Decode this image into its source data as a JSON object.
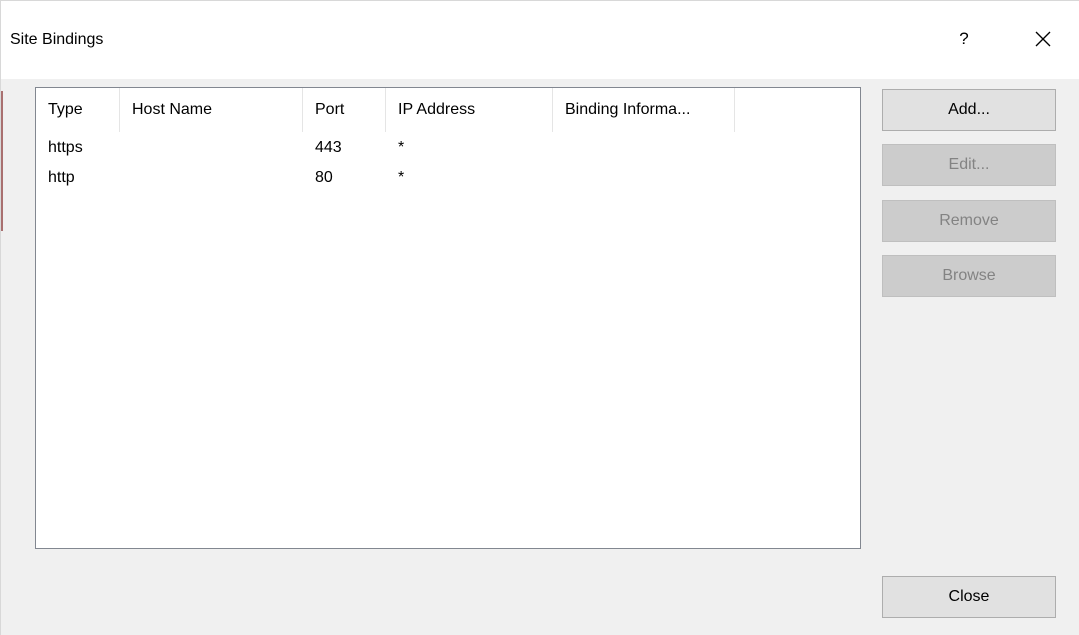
{
  "window": {
    "title": "Site Bindings",
    "help_label": "?"
  },
  "list": {
    "columns": [
      "Type",
      "Host Name",
      "Port",
      "IP Address",
      "Binding Informa..."
    ],
    "rows": [
      {
        "type": "https",
        "host_name": "",
        "port": "443",
        "ip_address": "*",
        "binding_info": ""
      },
      {
        "type": "http",
        "host_name": "",
        "port": "80",
        "ip_address": "*",
        "binding_info": ""
      }
    ]
  },
  "buttons": {
    "add": "Add...",
    "edit": "Edit...",
    "remove": "Remove",
    "browse": "Browse",
    "close": "Close"
  },
  "button_states": {
    "add": "enabled",
    "edit": "disabled",
    "remove": "disabled",
    "browse": "disabled",
    "close": "enabled"
  },
  "icons": {
    "close": "close-icon"
  }
}
